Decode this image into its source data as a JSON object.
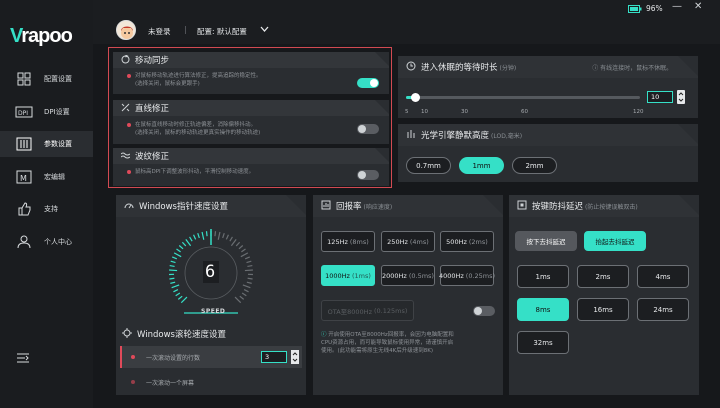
{
  "app": {
    "brand": "rapoo"
  },
  "topbar": {
    "user_status": "未登录",
    "divider": "|",
    "profile_label": "配置: 默认配置",
    "battery": "96%"
  },
  "sidebar": {
    "items": [
      {
        "label": "配置设置",
        "icon": "grid-icon"
      },
      {
        "label": "DPI设置",
        "icon": "dpi-icon"
      },
      {
        "label": "参数设置",
        "icon": "sliders-icon",
        "active": true
      },
      {
        "label": "宏编辑",
        "icon": "macro-icon"
      },
      {
        "label": "支持",
        "icon": "thumbs-up-icon"
      },
      {
        "label": "个人中心",
        "icon": "user-icon"
      }
    ]
  },
  "features": {
    "motion_sync": {
      "title": "移动同步",
      "desc1": "对鼠标移动轨迹进行算法修正，提高追踪的稳定性。",
      "desc2": "(选择关闭，鼠标会更跟手)",
      "enabled": true
    },
    "straight": {
      "title": "直线修正",
      "desc1": "在鼠标直线移动时修正轨迹偏差，消除偏移抖动。",
      "desc2": "(选择关闭，鼠标的移动轨迹更真实操作的移动轨迹)",
      "enabled": false
    },
    "ripple": {
      "title": "波纹修正",
      "desc1": "鼠标高DPI下调整波形抖动，平滑控制移动速度。",
      "enabled": false
    }
  },
  "sleep": {
    "title": "进入休眠的等待时长",
    "unit": "(分钟)",
    "note": "有线连接时，鼠标不休眠。",
    "value": "10",
    "ticks": [
      "5",
      "10",
      "30",
      "60",
      "120"
    ],
    "slider_fraction": 0.04
  },
  "lod": {
    "title": "光学引擎静默高度",
    "unit": "(LOD,毫米)",
    "options": [
      "0.7mm",
      "1mm",
      "2mm"
    ],
    "selected": 1
  },
  "pointer_speed": {
    "title": "Windows指针速度设置",
    "value": "6",
    "label": "SPEED",
    "level_fraction": 0.5
  },
  "scroll": {
    "title": "Windows滚轮速度设置",
    "opt1": "一次滚动设置的行数",
    "opt1_value": "3",
    "opt2": "一次滚动一个屏幕"
  },
  "polling": {
    "title": "回报率",
    "unit": "(响应速度)",
    "rates": [
      {
        "main": "125Hz",
        "sub": "(8ms)"
      },
      {
        "main": "250Hz",
        "sub": "(4ms)"
      },
      {
        "main": "500Hz",
        "sub": "(2ms)"
      },
      {
        "main": "1000Hz",
        "sub": "(1ms)"
      },
      {
        "main": "2000Hz",
        "sub": "(0.5ms)"
      },
      {
        "main": "4000Hz",
        "sub": "(0.25ms)"
      }
    ],
    "selected": 3,
    "ota": {
      "main": "OTA至8000Hz",
      "sub": "(0.125ms)"
    },
    "note1": "开启使用OTA至8000Hz回报率，会因为电脑配置和",
    "note2": "CPU资源占用，而可能导致鼠标使用异常，请谨慎开启",
    "note3": "使用。(此功能需将原生无线4K后升级速到8K)"
  },
  "debounce": {
    "title": "按键防抖延迟",
    "unit": "(防止按键误触双击)",
    "mode_press": "按下去抖延迟",
    "mode_lift": "抬起去抖延迟",
    "options": [
      "1ms",
      "2ms",
      "4ms",
      "8ms",
      "16ms",
      "24ms",
      "32ms"
    ],
    "selected": 3
  },
  "colors": {
    "accent": "#35e0c7",
    "panel": "#2a2d31",
    "alert": "#e04a5a"
  }
}
